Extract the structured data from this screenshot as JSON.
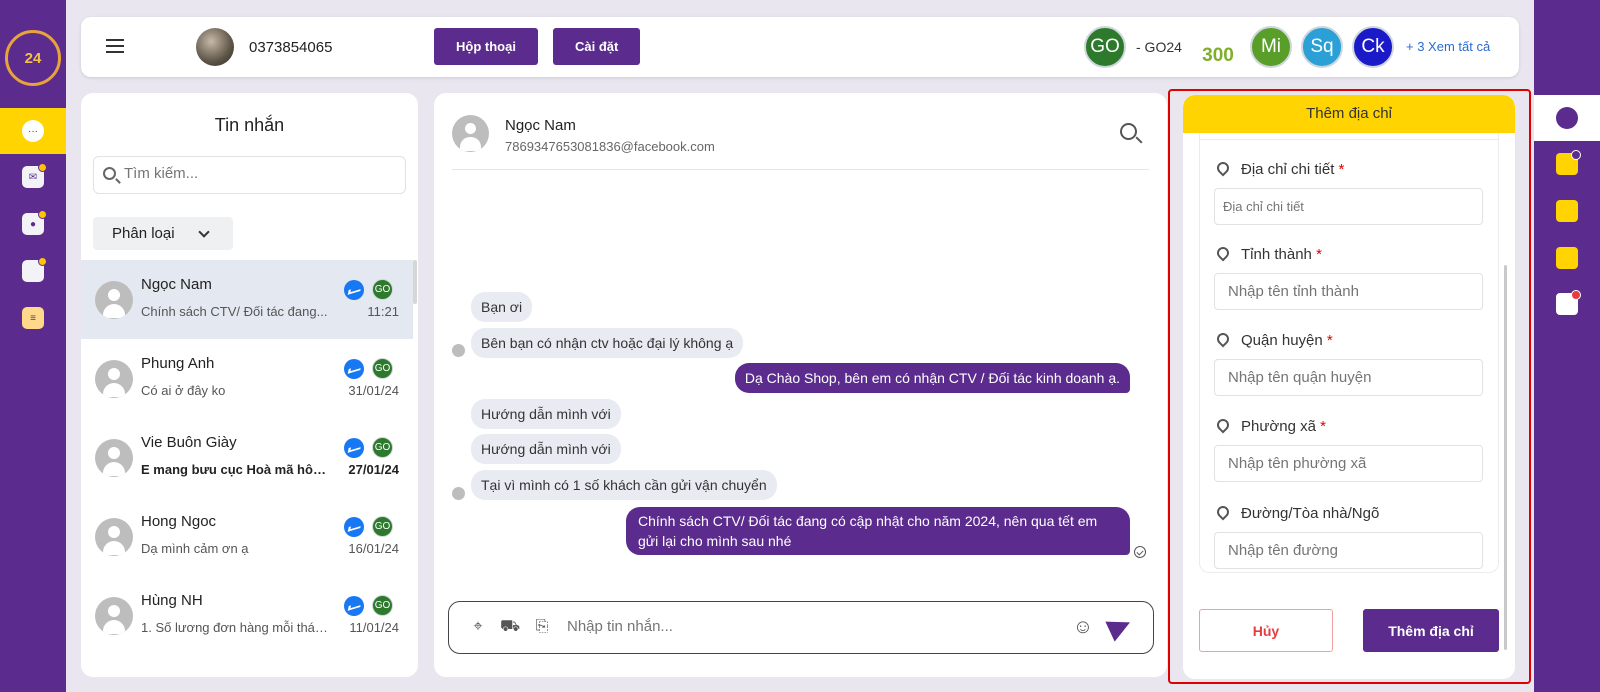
{
  "header": {
    "phone": "0373854065",
    "btn_conversations": "Hộp thoại",
    "btn_settings": "Cài đặt",
    "chip_go": "GO",
    "chip_go_label": "- GO24",
    "logo_300": "300",
    "chip_mi": "Mi",
    "chip_sq": "Sq",
    "chip_ck": "Ck",
    "see_all": "+ 3 Xem tất cả",
    "colors": {
      "go": "#2d7a2d",
      "mi": "#5a9e2a",
      "sq": "#2aa0d6",
      "ck": "#1a1ac8"
    }
  },
  "left_rail": {
    "logo_text": "24",
    "items": [
      {
        "icon": "chat-bubble-icon"
      },
      {
        "icon": "mail-icon"
      },
      {
        "icon": "inbox-user-icon"
      },
      {
        "icon": "folder-icon"
      },
      {
        "icon": "document-icon"
      }
    ]
  },
  "messages": {
    "title": "Tin nhắn",
    "search_placeholder": "Tìm kiếm...",
    "filter_label": "Phân loại",
    "badge": "GO",
    "conversations": [
      {
        "name": "Ngọc Nam",
        "preview": "Chính sách CTV/ Đối tác đang...",
        "time": "11:21"
      },
      {
        "name": "Phung Anh",
        "preview": "Có ai ở đây ko",
        "time": "31/01/24"
      },
      {
        "name": "Vie Buôn Giày",
        "preview": "E mang bưu cục Hoà mã hôm...",
        "time": "27/01/24"
      },
      {
        "name": "Hong Ngoc",
        "preview": "Dạ mình cảm ơn ạ",
        "time": "16/01/24"
      },
      {
        "name": "Hùng NH",
        "preview": "1. Số lương đơn hàng mỗi thán...",
        "time": "11/01/24"
      }
    ]
  },
  "chat": {
    "contact_name": "Ngọc Nam",
    "contact_email": "7869347653081836@facebook.com",
    "messages": [
      {
        "dir": "in",
        "text": "Bạn ơi"
      },
      {
        "dir": "in",
        "text": "Bên bạn có nhận ctv hoặc đại lý không ạ"
      },
      {
        "dir": "out",
        "text": "Dạ Chào Shop, bên em có nhận CTV / Đối tác kinh doanh ạ."
      },
      {
        "dir": "in",
        "text": "Hướng dẫn mình với"
      },
      {
        "dir": "in",
        "text": "Hướng dẫn mình với"
      },
      {
        "dir": "in",
        "text": "Tại vì mình có 1 số khách cần gửi vận chuyển"
      },
      {
        "dir": "out",
        "text": "Chính sách CTV/ Đối tác đang có cập nhật cho năm 2024, nên qua tết em gửi lại cho mình sau nhé"
      }
    ],
    "composer_placeholder": "Nhập tin nhắn..."
  },
  "address_form": {
    "title": "Thêm địa chỉ",
    "fields": [
      {
        "label": "Địa chỉ chi tiết",
        "required": "*",
        "placeholder": "Địa chỉ chi tiết"
      },
      {
        "label": "Tỉnh thành",
        "required": "*",
        "placeholder": "Nhập tên tỉnh thành"
      },
      {
        "label": "Quận huyện",
        "required": "*",
        "placeholder": "Nhập tên quận huyện"
      },
      {
        "label": "Phường xã",
        "required": "*",
        "placeholder": "Nhập tên phường xã"
      },
      {
        "label": "Đường/Tòa nhà/Ngõ",
        "required": "",
        "placeholder": "Nhập tên đường"
      }
    ],
    "cancel_label": "Hủy",
    "submit_label": "Thêm địa chỉ"
  },
  "right_rail": {
    "items": [
      {
        "icon": "user-profile-icon"
      },
      {
        "icon": "add-order-icon"
      },
      {
        "icon": "clipboard-icon"
      },
      {
        "icon": "clipboard-list-icon"
      },
      {
        "icon": "note-edit-icon"
      }
    ]
  },
  "theme": {
    "primary": "#5b2c8e",
    "accent": "#ffd400",
    "highlight": "#e10000"
  }
}
